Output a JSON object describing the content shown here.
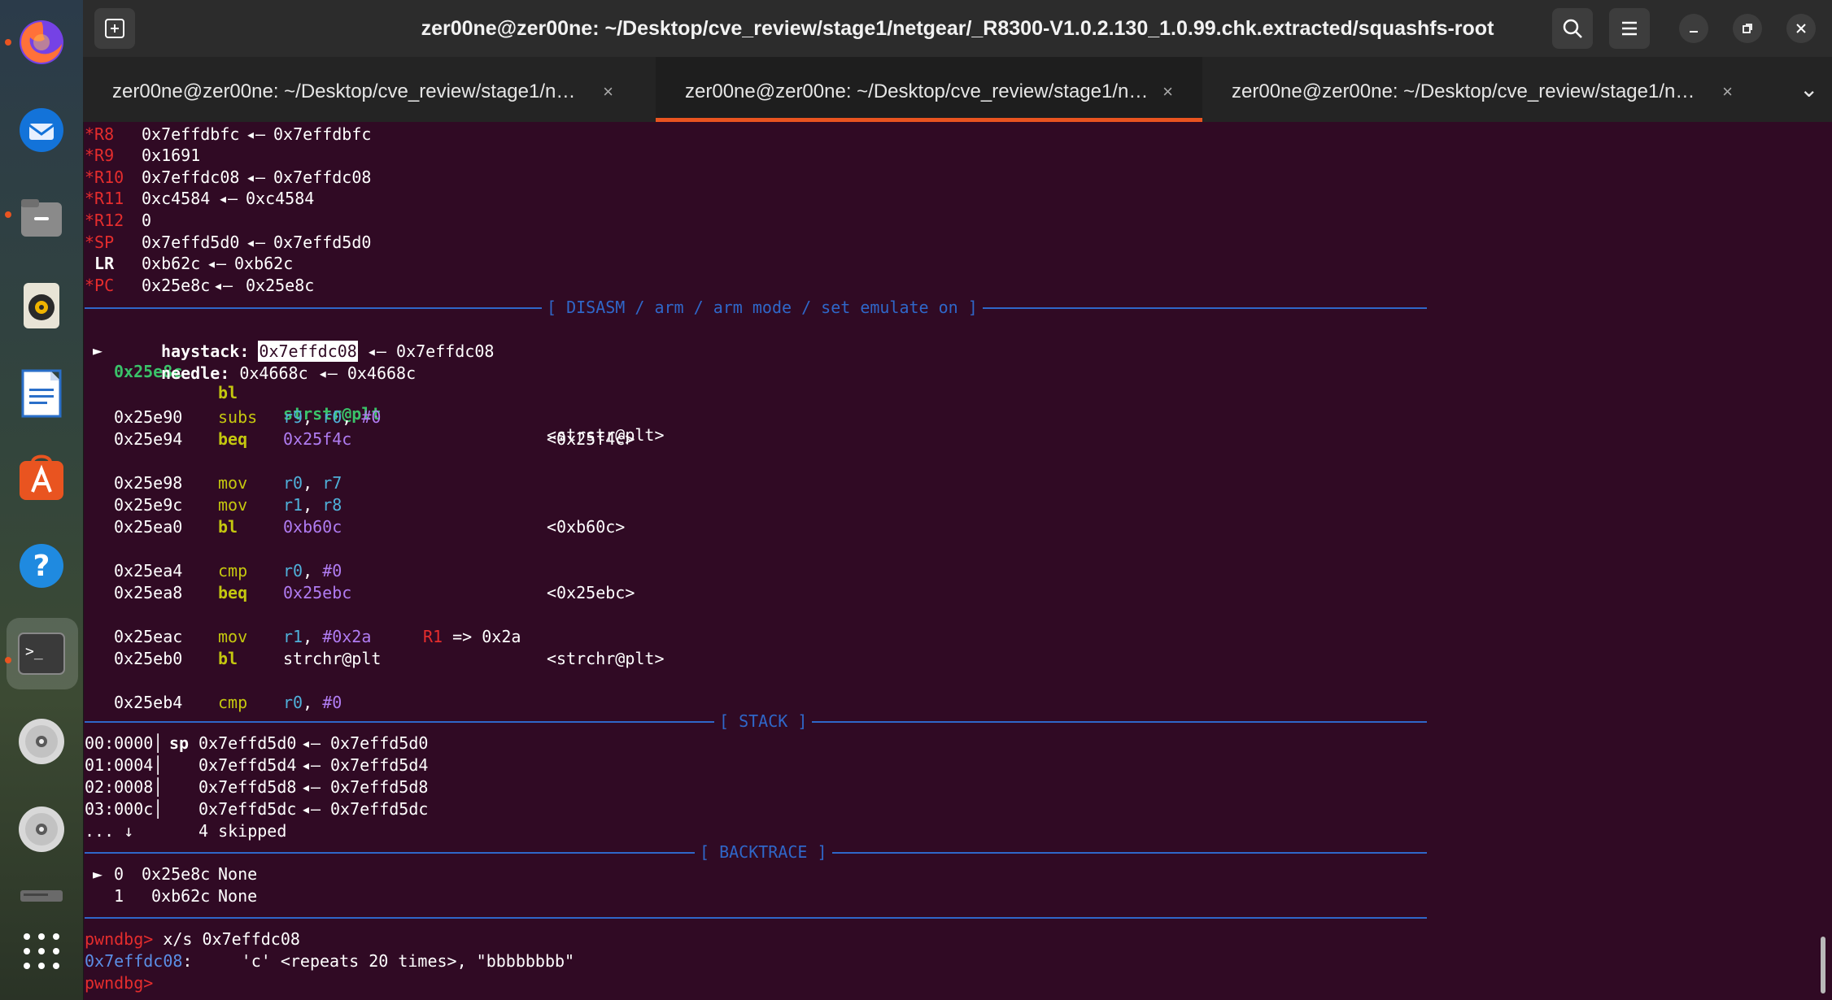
{
  "window": {
    "title": "zer00ne@zer00ne: ~/Desktop/cve_review/stage1/netgear/_R8300-V1.0.2.130_1.0.99.chk.extracted/squashfs-root"
  },
  "tabs": [
    {
      "label": "zer00ne@zer00ne: ~/Desktop/cve_review/stage1/n…",
      "active": false
    },
    {
      "label": "zer00ne@zer00ne: ~/Desktop/cve_review/stage1/n…",
      "active": true
    },
    {
      "label": "zer00ne@zer00ne: ~/Desktop/cve_review/stage1/n…",
      "active": false
    }
  ],
  "tab_close_glyph": "×",
  "tab_overflow_glyph": "⌄",
  "dock": {
    "items": [
      "firefox-icon",
      "thunderbird-icon",
      "files-icon",
      "rhythmbox-icon",
      "libreoffice-writer-icon",
      "app-center-icon",
      "help-icon",
      "terminal-icon",
      "disc-icon",
      "disc-icon",
      "drive-icon",
      "show-apps-icon"
    ],
    "terminal_prompt_glyph": ">_",
    "help_glyph": "?"
  },
  "registers": [
    {
      "star": "*",
      "name": "R8",
      "value": "0x7effdbfc",
      "arrow": "◂—",
      "target": "0x7effdbfc"
    },
    {
      "star": "*",
      "name": "R9",
      "value": "0x1691",
      "arrow": "",
      "target": ""
    },
    {
      "star": "*",
      "name": "R10",
      "value": "0x7effdc08",
      "arrow": "◂—",
      "target": "0x7effdc08"
    },
    {
      "star": "*",
      "name": "R11",
      "value": "0xc4584",
      "arrow": "◂—",
      "target": "0xc4584"
    },
    {
      "star": "*",
      "name": "R12",
      "value": "0",
      "arrow": "",
      "target": ""
    },
    {
      "star": "*",
      "name": "SP",
      "value": "0x7effd5d0",
      "arrow": "◂—",
      "target": "0x7effd5d0"
    },
    {
      "star": " ",
      "name": "LR",
      "value": "0xb62c",
      "arrow": "◂—",
      "target": "0xb62c"
    },
    {
      "star": "*",
      "name": "PC",
      "value": "0x25e8c",
      "arrow": "◂—",
      "target": "0x25e8c"
    }
  ],
  "disasm": {
    "banner": "[ DISASM / arm / arm mode / set emulate on ]",
    "current": {
      "marker": "►",
      "addr": "0x25e8c",
      "mnem": "bl",
      "op": "strstr@plt",
      "comment": "<strstr@plt>"
    },
    "args": [
      {
        "label": "haystack:",
        "value": "0x7effdc08",
        "arrow": "◂—",
        "target": "0x7effdc08"
      },
      {
        "label": "needle:",
        "value": "0x4668c",
        "arrow": "◂—",
        "target": "0x4668c"
      }
    ],
    "ins": [
      {
        "addr": "0x25e90",
        "mnem": "subs",
        "op1": "r9",
        "sep1": ", ",
        "op2": "r0",
        "sep2": ", ",
        "op3": "#0",
        "comment": ""
      },
      {
        "addr": "0x25e94",
        "mnem": "beq",
        "op1": "0x25f4c",
        "sep1": "",
        "op2": "",
        "sep2": "",
        "op3": "",
        "comment": "<0x25f4c>"
      },
      {
        "addr": "0x25e98",
        "mnem": "mov",
        "op1": "r0",
        "sep1": ", ",
        "op2": "r7",
        "sep2": "",
        "op3": "",
        "comment": ""
      },
      {
        "addr": "0x25e9c",
        "mnem": "mov",
        "op1": "r1",
        "sep1": ", ",
        "op2": "r8",
        "sep2": "",
        "op3": "",
        "comment": ""
      },
      {
        "addr": "0x25ea0",
        "mnem": "bl",
        "op1": "0xb60c",
        "sep1": "",
        "op2": "",
        "sep2": "",
        "op3": "",
        "comment": "<0xb60c>"
      },
      {
        "addr": "0x25ea4",
        "mnem": "cmp",
        "op1": "r0",
        "sep1": ", ",
        "op2": "#0",
        "sep2": "",
        "op3": "",
        "comment": ""
      },
      {
        "addr": "0x25ea8",
        "mnem": "beq",
        "op1": "0x25ebc",
        "sep1": "",
        "op2": "",
        "sep2": "",
        "op3": "",
        "comment": "<0x25ebc>"
      },
      {
        "addr": "0x25eac",
        "mnem": "mov",
        "op1": "r1",
        "sep1": ", ",
        "op2": "#0x2a",
        "sep2": "",
        "op3": "",
        "comment": ""
      },
      {
        "addr": "0x25eb0",
        "mnem": "bl",
        "op1": "strchr@plt",
        "sep1": "",
        "op2": "",
        "sep2": "",
        "op3": "",
        "comment": "<strchr@plt>"
      },
      {
        "addr": "0x25eb4",
        "mnem": "cmp",
        "op1": "r0",
        "sep1": ", ",
        "op2": "#0",
        "sep2": "",
        "op3": "",
        "comment": ""
      }
    ],
    "emu_note": {
      "reg": "R1",
      "text": " => 0x2a"
    }
  },
  "stack": {
    "banner": "[ STACK ]",
    "rows": [
      {
        "idx": "00:0000",
        "reg": "sp",
        "value": "0x7effd5d0",
        "arrow": "◂—",
        "target": "0x7effd5d0"
      },
      {
        "idx": "01:0004",
        "reg": "",
        "value": "0x7effd5d4",
        "arrow": "◂—",
        "target": "0x7effd5d4"
      },
      {
        "idx": "02:0008",
        "reg": "",
        "value": "0x7effd5d8",
        "arrow": "◂—",
        "target": "0x7effd5d8"
      },
      {
        "idx": "03:000c",
        "reg": "",
        "value": "0x7effd5dc",
        "arrow": "◂—",
        "target": "0x7effd5dc"
      }
    ],
    "skipped": {
      "prefix": "... ↓",
      "text": "4 skipped"
    },
    "separator": "│"
  },
  "backtrace": {
    "banner": "[ BACKTRACE ]",
    "frames": [
      {
        "marker": "►",
        "idx": "0",
        "addr": "0x25e8c",
        "sym": "None"
      },
      {
        "marker": " ",
        "idx": "1",
        "addr": "0xb62c",
        "sym": "None"
      }
    ]
  },
  "console": {
    "prompt": "pwndbg>",
    "command": " x/s 0x7effdc08",
    "result_addr": "0x7effdc08",
    "result_colon": ":",
    "result_text": "     'c' <repeats 20 times>, \"bbbbbbbb\"",
    "final_prompt": "pwndbg>"
  }
}
